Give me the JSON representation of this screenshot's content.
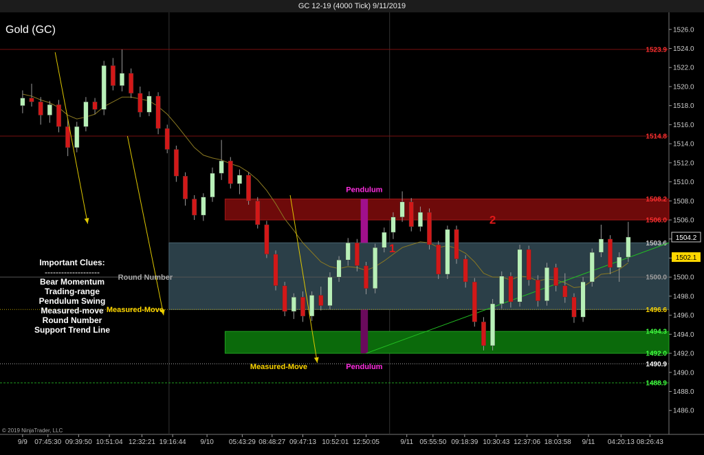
{
  "window": {
    "title": "GC 12-19 (4000 Tick)  9/11/2019"
  },
  "chart_data": {
    "type": "candlestick",
    "instrument_label": "Gold (GC)",
    "copyright": "© 2019 NinjaTrader, LLC",
    "ylim": [
      1484.5,
      1527.5
    ],
    "y_ticks": [
      1486.0,
      1488.0,
      1490.0,
      1492.0,
      1494.0,
      1496.0,
      1498.0,
      1500.0,
      1502.0,
      1504.0,
      1506.0,
      1508.0,
      1510.0,
      1512.0,
      1514.0,
      1516.0,
      1518.0,
      1520.0,
      1522.0,
      1524.0,
      1526.0
    ],
    "x_labels": [
      {
        "t": 0.0,
        "text": "9/9"
      },
      {
        "t": 2.8,
        "text": "07:45:30"
      },
      {
        "t": 6.2,
        "text": "09:39:50"
      },
      {
        "t": 9.6,
        "text": "10:51:04"
      },
      {
        "t": 13.2,
        "text": "12:32:21"
      },
      {
        "t": 16.6,
        "text": "19:16:44"
      },
      {
        "t": 20.4,
        "text": "9/10"
      },
      {
        "t": 24.3,
        "text": "05:43:29"
      },
      {
        "t": 27.6,
        "text": "08:48:27"
      },
      {
        "t": 31.0,
        "text": "09:47:13"
      },
      {
        "t": 34.6,
        "text": "10:52:01"
      },
      {
        "t": 38.0,
        "text": "12:50:05"
      },
      {
        "t": 42.5,
        "text": "9/11"
      },
      {
        "t": 45.4,
        "text": "05:55:50"
      },
      {
        "t": 48.9,
        "text": "09:18:39"
      },
      {
        "t": 52.4,
        "text": "10:30:43"
      },
      {
        "t": 55.8,
        "text": "12:37:06"
      },
      {
        "t": 59.2,
        "text": "18:03:58"
      },
      {
        "t": 62.6,
        "text": "9/11"
      },
      {
        "t": 66.2,
        "text": "04:20:13"
      },
      {
        "t": 69.4,
        "text": "08:26:43"
      }
    ],
    "x_range": [
      -2.5,
      71.5
    ],
    "session_breaks": [
      16.2,
      40.6
    ],
    "price_levels": [
      {
        "value": 1523.9,
        "label": "1523.9",
        "color": "#ff3030",
        "line": "#7a1010",
        "style": "solid"
      },
      {
        "value": 1514.8,
        "label": "1514.8",
        "color": "#ff3030",
        "line": "#7a1010",
        "style": "solid"
      },
      {
        "value": 1508.2,
        "label": "1508.2",
        "color": "#ff3030",
        "line": null,
        "style": "none"
      },
      {
        "value": 1506.0,
        "label": "1506.0",
        "color": "#ff3030",
        "line": null,
        "style": "none"
      },
      {
        "value": 1503.6,
        "label": "1503.6",
        "color": "#c8c8c8",
        "line": null,
        "style": "none"
      },
      {
        "value": 1500.0,
        "label": "1500.0",
        "color": "#a0a0a0",
        "line": "#555",
        "style": "solid"
      },
      {
        "value": 1496.6,
        "label": "1496.6",
        "color": "#ffd700",
        "line": "#b8a000",
        "style": "dotted"
      },
      {
        "value": 1494.3,
        "label": "1494.3",
        "color": "#40ff40",
        "line": null,
        "style": "none"
      },
      {
        "value": 1492.0,
        "label": "1492.0",
        "color": "#40ff40",
        "line": null,
        "style": "none"
      },
      {
        "value": 1490.9,
        "label": "1490.9",
        "color": "#ffffff",
        "line": "#aaa",
        "style": "dotted"
      },
      {
        "value": 1488.9,
        "label": "1488.9",
        "color": "#40ff40",
        "line": "#1fa01f",
        "style": "dashed"
      }
    ],
    "last_price": {
      "value": 1504.2,
      "label": "1504.2"
    },
    "ma_price": {
      "value": 1502.1,
      "label": "1502.1"
    },
    "zones": [
      {
        "name": "resistance-zone",
        "t0": 22.4,
        "t1": 71.5,
        "top": 1508.2,
        "bottom": 1506.0,
        "fill": "#6e0a0a",
        "stroke": "#a01818"
      },
      {
        "name": "trading-range-zone",
        "t0": 16.2,
        "t1": 71.5,
        "top": 1503.6,
        "bottom": 1496.6,
        "fill": "#2b3f48",
        "stroke": "#4a6470"
      },
      {
        "name": "support-zone",
        "t0": 22.4,
        "t1": 71.5,
        "top": 1494.3,
        "bottom": 1492.0,
        "fill": "#0b6a0b",
        "stroke": "#22a022"
      },
      {
        "name": "pendulum-top-bar",
        "t0": 37.4,
        "t1": 38.2,
        "top": 1508.2,
        "bottom": 1503.6,
        "fill": "#a0108c",
        "stroke": null
      },
      {
        "name": "pendulum-bottom-bar",
        "t0": 37.4,
        "t1": 38.2,
        "top": 1496.6,
        "bottom": 1492.0,
        "fill": "#6a0a5c",
        "stroke": null
      }
    ],
    "candles": [
      [
        1518.0,
        1519.6,
        1517.2,
        1518.8
      ],
      [
        1518.8,
        1520.3,
        1517.9,
        1518.4
      ],
      [
        1518.4,
        1518.9,
        1516.0,
        1517.0
      ],
      [
        1517.0,
        1518.5,
        1516.2,
        1518.1
      ],
      [
        1518.1,
        1518.6,
        1515.2,
        1515.8
      ],
      [
        1515.8,
        1516.6,
        1512.7,
        1513.6
      ],
      [
        1513.6,
        1516.3,
        1513.1,
        1515.8
      ],
      [
        1515.8,
        1518.9,
        1515.3,
        1518.4
      ],
      [
        1518.4,
        1518.8,
        1517.1,
        1517.6
      ],
      [
        1517.6,
        1522.7,
        1517.0,
        1522.2
      ],
      [
        1522.2,
        1523.0,
        1519.6,
        1520.1
      ],
      [
        1520.1,
        1523.9,
        1519.5,
        1521.4
      ],
      [
        1521.4,
        1521.9,
        1518.8,
        1519.3
      ],
      [
        1519.3,
        1520.0,
        1516.8,
        1517.3
      ],
      [
        1517.3,
        1519.5,
        1516.9,
        1519.0
      ],
      [
        1519.0,
        1519.4,
        1515.0,
        1515.6
      ],
      [
        1515.6,
        1516.0,
        1513.0,
        1513.4
      ],
      [
        1513.4,
        1513.8,
        1510.0,
        1510.6
      ],
      [
        1510.6,
        1511.0,
        1507.5,
        1508.2
      ],
      [
        1508.2,
        1508.6,
        1506.0,
        1506.5
      ],
      [
        1506.5,
        1508.8,
        1505.9,
        1508.4
      ],
      [
        1508.4,
        1511.5,
        1507.9,
        1510.9
      ],
      [
        1510.9,
        1514.4,
        1510.2,
        1512.2
      ],
      [
        1512.2,
        1512.6,
        1509.3,
        1509.8
      ],
      [
        1509.8,
        1511.3,
        1508.7,
        1510.7
      ],
      [
        1510.7,
        1511.0,
        1507.6,
        1508.0
      ],
      [
        1508.0,
        1508.4,
        1505.1,
        1505.5
      ],
      [
        1505.5,
        1505.9,
        1502.0,
        1502.4
      ],
      [
        1502.4,
        1502.8,
        1498.6,
        1499.1
      ],
      [
        1499.1,
        1499.5,
        1495.9,
        1496.4
      ],
      [
        1496.4,
        1498.3,
        1495.6,
        1497.9
      ],
      [
        1497.9,
        1498.5,
        1495.3,
        1495.9
      ],
      [
        1495.9,
        1498.5,
        1495.4,
        1498.1
      ],
      [
        1498.1,
        1499.0,
        1496.5,
        1497.0
      ],
      [
        1497.0,
        1500.5,
        1496.6,
        1500.0
      ],
      [
        1500.0,
        1502.2,
        1499.5,
        1501.8
      ],
      [
        1501.8,
        1504.1,
        1501.2,
        1503.6
      ],
      [
        1503.6,
        1504.0,
        1500.6,
        1501.2
      ],
      [
        1501.2,
        1501.6,
        1498.2,
        1498.8
      ],
      [
        1498.8,
        1503.5,
        1498.3,
        1503.1
      ],
      [
        1503.1,
        1505.2,
        1502.6,
        1504.7
      ],
      [
        1504.7,
        1506.8,
        1504.0,
        1506.3
      ],
      [
        1506.3,
        1509.0,
        1505.8,
        1507.9
      ],
      [
        1507.9,
        1508.3,
        1504.8,
        1505.3
      ],
      [
        1505.3,
        1507.4,
        1504.8,
        1506.8
      ],
      [
        1506.8,
        1507.2,
        1502.9,
        1503.4
      ],
      [
        1503.4,
        1503.8,
        1499.8,
        1500.3
      ],
      [
        1500.3,
        1505.4,
        1499.8,
        1505.0
      ],
      [
        1505.0,
        1505.4,
        1501.4,
        1501.9
      ],
      [
        1501.9,
        1502.3,
        1498.9,
        1499.5
      ],
      [
        1499.5,
        1499.9,
        1494.8,
        1495.3
      ],
      [
        1495.3,
        1495.8,
        1492.3,
        1492.8
      ],
      [
        1492.8,
        1497.7,
        1492.3,
        1497.2
      ],
      [
        1497.2,
        1500.6,
        1496.7,
        1500.1
      ],
      [
        1500.1,
        1500.5,
        1496.8,
        1497.4
      ],
      [
        1497.4,
        1503.4,
        1496.9,
        1502.9
      ],
      [
        1502.9,
        1503.3,
        1499.1,
        1499.7
      ],
      [
        1499.7,
        1500.2,
        1496.9,
        1497.5
      ],
      [
        1497.5,
        1501.5,
        1497.0,
        1501.0
      ],
      [
        1501.0,
        1501.4,
        1498.5,
        1499.1
      ],
      [
        1499.1,
        1500.4,
        1497.3,
        1497.9
      ],
      [
        1497.9,
        1498.3,
        1495.2,
        1495.8
      ],
      [
        1495.8,
        1500.0,
        1495.3,
        1499.5
      ],
      [
        1499.5,
        1503.0,
        1499.0,
        1502.6
      ],
      [
        1502.6,
        1505.5,
        1502.1,
        1504.0
      ],
      [
        1504.0,
        1504.4,
        1500.3,
        1501.0
      ],
      [
        1501.0,
        1502.6,
        1499.5,
        1502.1
      ],
      [
        1502.1,
        1505.8,
        1501.6,
        1504.2
      ]
    ],
    "trend_line": {
      "t0": 38.0,
      "v0": 1492.0,
      "t1": 71.5,
      "v1": 1503.6,
      "color": "#22c022"
    },
    "arrows": [
      {
        "t0": 3.6,
        "v0": 1523.6,
        "t1": 7.2,
        "v1": 1505.6,
        "color": "#e0c800"
      },
      {
        "t0": 11.6,
        "v0": 1514.8,
        "t1": 15.6,
        "v1": 1496.0,
        "color": "#e0c800"
      },
      {
        "t0": 29.6,
        "v0": 1508.6,
        "t1": 32.6,
        "v1": 1491.0,
        "color": "#e0c800"
      }
    ],
    "annotations": [
      {
        "t": 37.8,
        "v": 1509.2,
        "text": "Pendulum",
        "color": "#ff2ee0",
        "size": 11,
        "anchor": "middle"
      },
      {
        "t": 37.8,
        "v": 1490.6,
        "text": "Pendulum",
        "color": "#ff2ee0",
        "size": 11,
        "anchor": "middle"
      },
      {
        "t": 40.9,
        "v": 1503.0,
        "text": "1",
        "color": "#e01818",
        "size": 17,
        "anchor": "middle"
      },
      {
        "t": 52.0,
        "v": 1506.0,
        "text": "2",
        "color": "#e01818",
        "size": 17,
        "anchor": "middle"
      },
      {
        "t": 15.6,
        "v": 1496.6,
        "text": "Measured-Move",
        "color": "#ffd700",
        "size": 11,
        "anchor": "end"
      },
      {
        "t": 31.5,
        "v": 1490.6,
        "text": "Measured-Move",
        "color": "#ffd700",
        "size": 11,
        "anchor": "end"
      },
      {
        "t": 16.6,
        "v": 1500.0,
        "text": "Round Number",
        "color": "#a8a8a8",
        "size": 11,
        "anchor": "end"
      }
    ],
    "clues": {
      "heading": "Important Clues:",
      "divider": "--------------------",
      "items": [
        "Bear Momentum",
        "Trading-range",
        "Pendulum Swing",
        "Measured-move",
        "Round Number",
        "Support Trend Line"
      ]
    },
    "ma": [
      1519.2,
      1519.0,
      1518.6,
      1518.3,
      1517.8,
      1517.0,
      1516.6,
      1516.8,
      1517.1,
      1517.9,
      1518.4,
      1518.9,
      1518.9,
      1518.7,
      1518.5,
      1517.9,
      1517.1,
      1516.0,
      1514.8,
      1513.6,
      1512.8,
      1512.5,
      1512.3,
      1511.9,
      1511.6,
      1511.0,
      1510.2,
      1509.1,
      1507.7,
      1506.1,
      1504.9,
      1503.6,
      1502.6,
      1501.6,
      1501.1,
      1500.9,
      1501.1,
      1501.0,
      1500.7,
      1501.1,
      1501.7,
      1502.4,
      1503.1,
      1503.4,
      1503.7,
      1503.6,
      1503.1,
      1503.3,
      1503.0,
      1502.5,
      1501.6,
      1500.4,
      1500.0,
      1500.0,
      1499.7,
      1500.1,
      1500.0,
      1499.6,
      1499.8,
      1499.7,
      1499.4,
      1498.9,
      1499.0,
      1499.6,
      1500.3,
      1500.4,
      1500.8,
      1501.5
    ]
  }
}
